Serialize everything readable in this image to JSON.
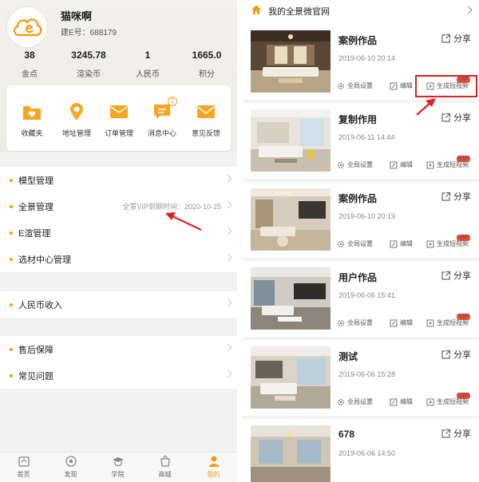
{
  "profile": {
    "name": "猫咪啊",
    "id": "建E号：688179",
    "avatar": "cloud-e-avatar"
  },
  "stats": [
    {
      "value": "38",
      "label": "金点"
    },
    {
      "value": "3245.78",
      "label": "渲染币"
    },
    {
      "value": "1",
      "label": "人民币"
    },
    {
      "value": "1665.0",
      "label": "积分"
    }
  ],
  "shortcuts": [
    {
      "label": "收藏夹",
      "icon": "folder-heart-icon"
    },
    {
      "label": "地址管理",
      "icon": "location-pin-icon"
    },
    {
      "label": "订单管理",
      "icon": "envelope-icon"
    },
    {
      "label": "消息中心",
      "icon": "message-icon",
      "badge": "2"
    },
    {
      "label": "意见反馈",
      "icon": "mail-icon"
    }
  ],
  "menu_group_1": [
    {
      "label": "模型管理",
      "note": ""
    },
    {
      "label": "全景管理",
      "note": "全景VIP到期时间：2020-10-25"
    },
    {
      "label": "E渲管理",
      "note": ""
    },
    {
      "label": "选材中心管理",
      "note": ""
    }
  ],
  "menu_group_2": [
    {
      "label": "人民币收入"
    }
  ],
  "menu_group_3": [
    {
      "label": "售后保障"
    },
    {
      "label": "常见问题"
    }
  ],
  "tabbar": [
    {
      "label": "首页",
      "icon": "home-icon",
      "active": false
    },
    {
      "label": "发现",
      "icon": "discover-icon",
      "active": false
    },
    {
      "label": "学院",
      "icon": "academy-icon",
      "active": false
    },
    {
      "label": "商城",
      "icon": "shop-icon",
      "active": false
    },
    {
      "label": "我的",
      "icon": "user-icon",
      "active": true
    }
  ],
  "right": {
    "title": "我的全景微官网",
    "share_label": "分享",
    "actions": {
      "settings": "全局设置",
      "edit": "编辑",
      "video": "生成短视频",
      "vip": "VIP"
    },
    "works": [
      {
        "title": "案例作品",
        "date": "2019-06-10 20:14"
      },
      {
        "title": "复制作用",
        "date": "2019-06-11 14:44"
      },
      {
        "title": "案例作品",
        "date": "2019-06-10 20:19"
      },
      {
        "title": "用户作品",
        "date": "2019-06-06 15:41"
      },
      {
        "title": "测试",
        "date": "2019-06-06 15:28"
      },
      {
        "title": "678",
        "date": "2019-06-06 14:50"
      }
    ]
  },
  "colors": {
    "accent": "#f39c12",
    "highlight": "#e02020",
    "vip": "#e74c3c"
  }
}
